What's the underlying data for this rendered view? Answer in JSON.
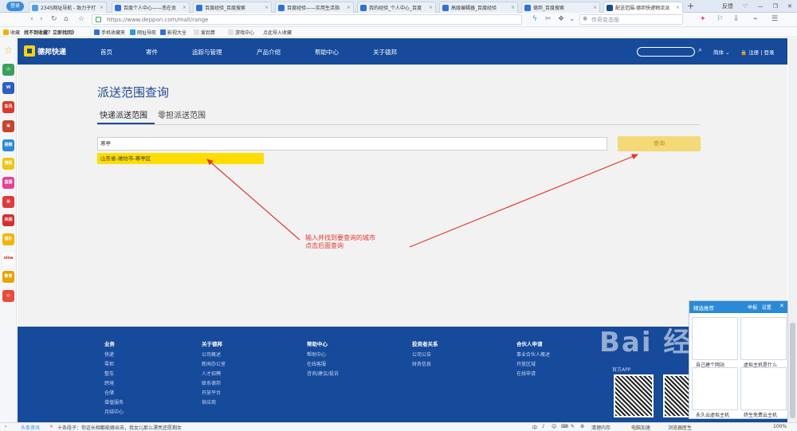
{
  "browser": {
    "login_label": "登录",
    "tabs": [
      {
        "title": "2345网址导航 - 致力于打",
        "color": "#4aa0e8",
        "active": false
      },
      {
        "title": "百度个人中心——悲在贡",
        "color": "#2f6fe0",
        "active": false
      },
      {
        "title": "百度经验_百度搜索",
        "color": "#2f6fe0",
        "active": false
      },
      {
        "title": "百度经验——实用生活指",
        "color": "#2f6fe0",
        "active": false
      },
      {
        "title": "我的经验_个人中心_百度",
        "color": "#2f6fe0",
        "active": false
      },
      {
        "title": "高级编辑器_百度经验",
        "color": "#2f6fe0",
        "active": false
      },
      {
        "title": "德邦_百度搜索",
        "color": "#2f6fe0",
        "active": false
      },
      {
        "title": "配送范围-德邦快递物流派",
        "color": "#164a9b",
        "active": true
      }
    ],
    "new_tab": "+",
    "window_controls": [
      "反馈",
      "♡",
      "—",
      "❐",
      "✕"
    ],
    "url": "https://www.deppon.com/mall/range",
    "search_placeholder": "传奇变态版",
    "nav_icons": [
      "‹",
      "›",
      "↻",
      "⌂",
      "☆"
    ],
    "right_icons": [
      "✦",
      "⚐",
      "⇩",
      "⌁",
      "☰"
    ]
  },
  "bookmarks": [
    {
      "label": "收藏",
      "bold": false,
      "color": "#f3b400"
    },
    {
      "label": "找不到收藏？立即找回》",
      "bold": true,
      "color": ""
    },
    {
      "label": "手机收藏夹",
      "bold": false,
      "color": "#2f6fe0"
    },
    {
      "label": "网址导航",
      "bold": false,
      "color": "#2f9ae0"
    },
    {
      "label": "影视大全",
      "bold": false,
      "color": "#2f6fe0"
    },
    {
      "label": "爱劲算",
      "bold": false,
      "color": "#e0e0e0"
    },
    {
      "label": "游戏中心",
      "bold": false,
      "color": "#e0e0e0"
    },
    {
      "label": "点此导入收藏",
      "bold": false,
      "color": ""
    }
  ],
  "sidebar": [
    {
      "label": "☆",
      "color": "#f5b800",
      "name": "sidebar-favorites-icon"
    },
    {
      "label": "◷",
      "color": "#3aa05a",
      "name": "sidebar-history-icon"
    },
    {
      "label": "W",
      "color": "#2b5fc7",
      "name": "sidebar-word-icon"
    },
    {
      "label": "车讯",
      "color": "#d93a2b",
      "name": "sidebar-car-icon"
    },
    {
      "label": "▣",
      "color": "#c8452d",
      "name": "sidebar-game-icon"
    },
    {
      "label": "视频",
      "color": "#2a8ad8",
      "name": "sidebar-video-icon"
    },
    {
      "label": "搜狐",
      "color": "#f1c40f",
      "name": "sidebar-sohu-icon"
    },
    {
      "label": "直播",
      "color": "#e84393",
      "name": "sidebar-live-icon"
    },
    {
      "label": "▦",
      "color": "#e03a3a",
      "name": "sidebar-apps-icon"
    },
    {
      "label": "央视",
      "color": "#d92d2d",
      "name": "sidebar-cctv-icon"
    },
    {
      "label": "猫扑",
      "color": "#f2b600",
      "name": "sidebar-mop-icon"
    },
    {
      "label": "sina",
      "color": "#ffffff",
      "name": "sidebar-sina-icon"
    },
    {
      "label": "教育",
      "color": "#e8a300",
      "name": "sidebar-edu-icon"
    },
    {
      "label": "◎",
      "color": "#e84c3d",
      "name": "sidebar-netease-icon"
    }
  ],
  "site": {
    "logo_text": "德邦快递",
    "nav": [
      "首页",
      "寄件",
      "追踪与管理",
      "产品介绍",
      "帮助中心",
      "关于德邦"
    ],
    "lang": "简体 ⌄",
    "register": "注册",
    "separator": "|",
    "login": "登录"
  },
  "main": {
    "title": "派送范围查询",
    "tabs": [
      "快递派送范围",
      "零担派送范围"
    ],
    "city_input_value": "寒亭",
    "suggestion": "山东省-潍坊市-寒亭区",
    "query_button": "查询",
    "annotation_line1": "输入并找到要查询的城市",
    "annotation_line2": "点击后面查询"
  },
  "footer": {
    "columns": [
      {
        "heading": "业务",
        "items": [
          "快递",
          "零担",
          "整车",
          "跨境",
          "仓储",
          "增值服务",
          "月结中心"
        ]
      },
      {
        "heading": "关于德邦",
        "items": [
          "公司概述",
          "新闻办公室",
          "人才招聘",
          "联系德邦",
          "开放平台",
          "供应商"
        ]
      },
      {
        "heading": "帮助中心",
        "items": [
          "帮助中心",
          "在线客服",
          "咨询/建议/投诉"
        ]
      },
      {
        "heading": "投资者关系",
        "items": [
          "公司公告",
          "财务信息"
        ]
      },
      {
        "heading": "合伙人申请",
        "items": [
          "事业合伙人概述",
          "开放区域",
          "在线申请"
        ]
      }
    ],
    "app_label": "官方APP"
  },
  "watermark": "Bai 经验",
  "popup": {
    "title": "精选推荐",
    "report": "举报",
    "settings": "设置",
    "close": "✕",
    "cards": [
      {
        "caption": "自己建个网站"
      },
      {
        "caption": "虚拟主机是什么"
      },
      {
        "caption": "永久云虚拟主机"
      },
      {
        "caption": "终生免费云主机"
      }
    ]
  },
  "statusbar": {
    "news": "头条资讯",
    "headline": "十条段子：你这长相都能嫁出去，我女儿那么漂亮还愿剩女",
    "right_items": [
      "中",
      "♪",
      "☺",
      "⌨",
      "✎",
      "⚙",
      "清理内存",
      "电脑加速",
      "浏览器医生",
      "100%"
    ]
  }
}
